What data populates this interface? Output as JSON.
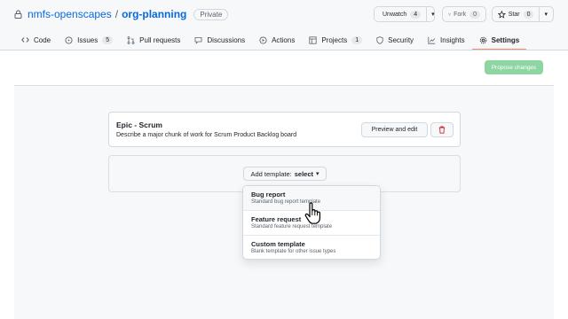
{
  "repo": {
    "owner": "nmfs-openscapes",
    "separator": "/",
    "name": "org-planning",
    "visibility": "Private"
  },
  "actions": {
    "watch": {
      "label": "Unwatch",
      "count": "4"
    },
    "fork": {
      "label": "Fork",
      "count": "0"
    },
    "star": {
      "label": "Star",
      "count": "0"
    }
  },
  "nav": {
    "tabs": [
      {
        "label": "Code",
        "icon": "code-icon"
      },
      {
        "label": "Issues",
        "icon": "issue-icon",
        "count": "5"
      },
      {
        "label": "Pull requests",
        "icon": "pull-request-icon"
      },
      {
        "label": "Discussions",
        "icon": "comment-icon"
      },
      {
        "label": "Actions",
        "icon": "play-icon"
      },
      {
        "label": "Projects",
        "icon": "table-icon",
        "count": "1"
      },
      {
        "label": "Security",
        "icon": "shield-icon"
      },
      {
        "label": "Insights",
        "icon": "graph-icon"
      },
      {
        "label": "Settings",
        "icon": "gear-icon",
        "selected": true
      }
    ]
  },
  "propose_button": "Propose changes",
  "template": {
    "title": "Epic - Scrum",
    "description": "Describe a major chunk of work for Scrum Product Backlog board",
    "preview_button": "Preview and edit"
  },
  "add_template": {
    "label": "Add template:",
    "value": "select"
  },
  "dropdown": {
    "items": [
      {
        "title": "Bug report",
        "description": "Standard bug report template"
      },
      {
        "title": "Feature request",
        "description": "Standard feature request template"
      },
      {
        "title": "Custom template",
        "description": "Blank template for other issue types"
      }
    ]
  },
  "colors": {
    "accent": "#0969da",
    "propose": "#8ed6a1",
    "selected_tab_underline": "#fd8c73",
    "delete_icon": "#cf222e"
  }
}
